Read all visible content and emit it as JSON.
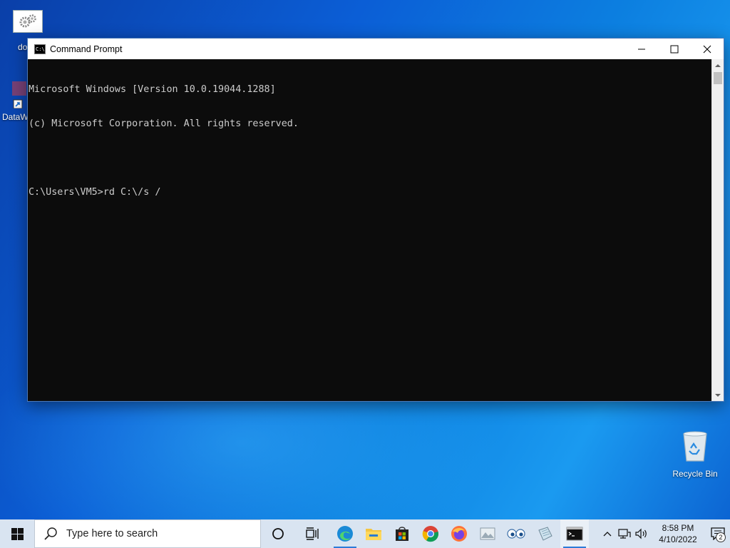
{
  "desktop": {
    "icons": [
      {
        "label": "do",
        "icon": "settings-gears-icon"
      },
      {
        "label": "DataW",
        "icon": "shortcut-icon"
      },
      {
        "label": "Recycle Bin",
        "icon": "recycle-bin-icon"
      }
    ]
  },
  "window": {
    "title": "Command Prompt",
    "icon": "console-icon",
    "controls": {
      "minimize": "minimize-icon",
      "maximize": "maximize-icon",
      "close": "close-icon"
    },
    "console_lines": [
      "Microsoft Windows [Version 10.0.19044.1288]",
      "(c) Microsoft Corporation. All rights reserved.",
      "",
      "C:\\Users\\VM5>rd C:\\/s /"
    ],
    "colors": {
      "background": "#0c0c0c",
      "text": "#cccccc"
    }
  },
  "taskbar": {
    "search_placeholder": "Type here to search",
    "apps": [
      {
        "name": "cortana-icon"
      },
      {
        "name": "task-view-icon"
      },
      {
        "name": "edge-icon"
      },
      {
        "name": "file-explorer-icon"
      },
      {
        "name": "store-icon"
      },
      {
        "name": "chrome-icon"
      },
      {
        "name": "firefox-icon"
      },
      {
        "name": "image-viewer-icon"
      },
      {
        "name": "eyes-app-icon"
      },
      {
        "name": "notepad-icon"
      },
      {
        "name": "command-prompt-icon"
      }
    ],
    "tray": {
      "time": "8:58 PM",
      "date": "4/10/2022",
      "notification_count": "2"
    }
  }
}
